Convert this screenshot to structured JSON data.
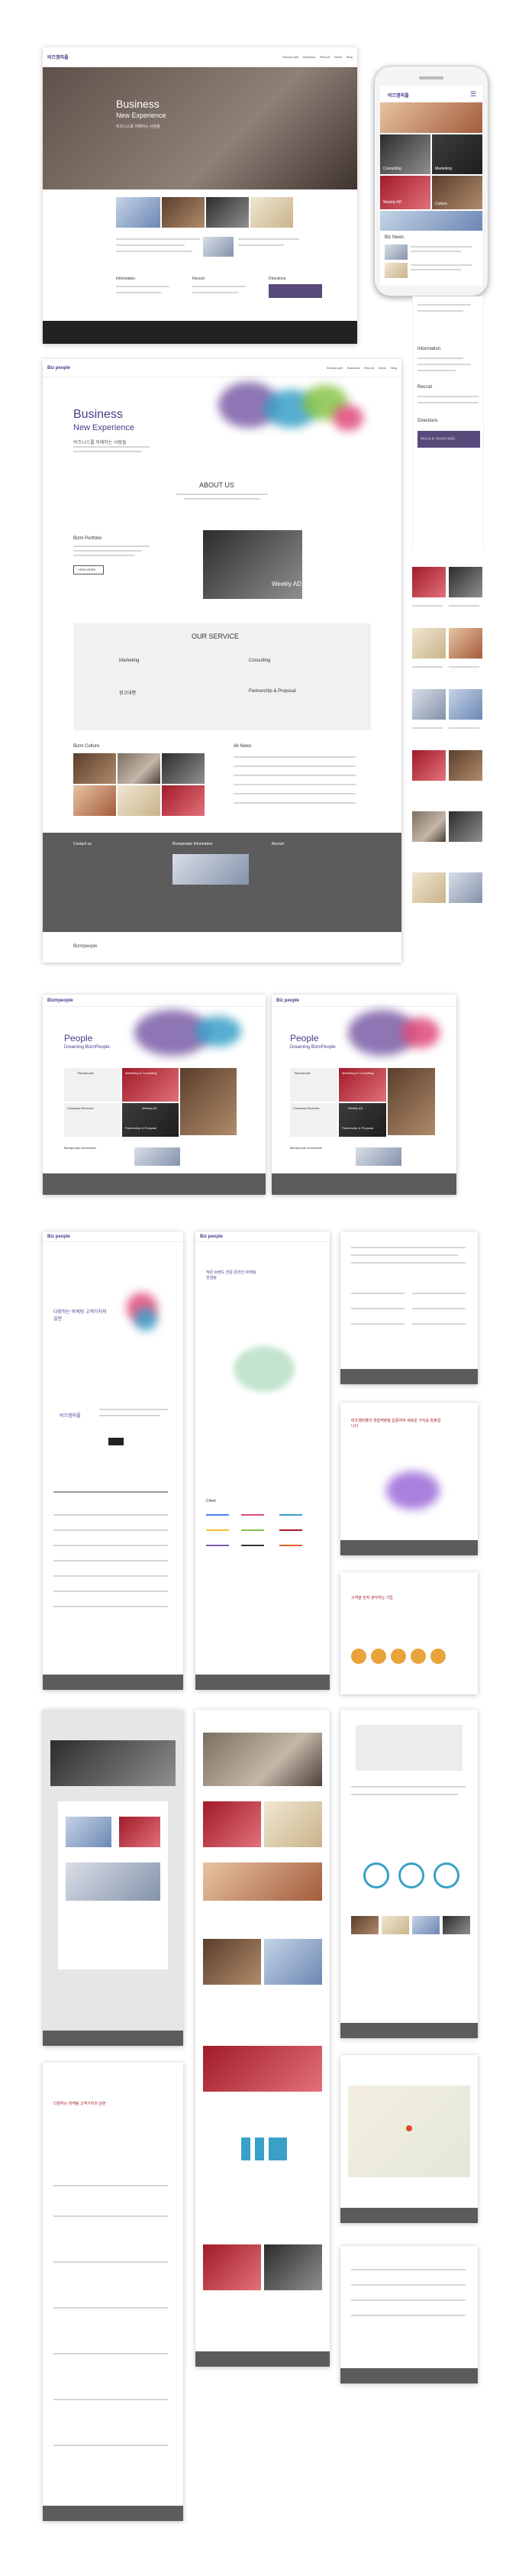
{
  "brand": {
    "logo_text": "비즈엠피플",
    "logo_en": "Biz people",
    "accent": "#574a7a",
    "splash_colors": [
      "#7b5ea7",
      "#3aa0c8",
      "#e04a7a",
      "#88c447",
      "#f2c230"
    ]
  },
  "nav": {
    "items": [
      "Bizmpeople",
      "Business",
      "Recruit",
      "News",
      "Blog"
    ]
  },
  "mock1": {
    "hero_title": "Business",
    "hero_subtitle": "New Experience",
    "hero_desc": "비즈니스를 지배하는 사람들",
    "sections": [
      "Information",
      "Recruit",
      "Directions"
    ]
  },
  "phone": {
    "logo": "비즈엠피플",
    "tile_labels": [
      "Consulting",
      "Marketing",
      "Culture"
    ],
    "weekly_label": "Weekly AD",
    "news_title": "Biz News",
    "info_title": "Information",
    "recruit_title": "Recruit",
    "directions_title": "Directions",
    "directions_button": "찾아오시는 길 / 회사소개서 다운로드"
  },
  "mock2": {
    "hero_title": "Business",
    "hero_subtitle": "New Experience",
    "hero_desc": "비즈니스를 지배하는 사람들",
    "about_title": "ABOUT US",
    "portfolio_title": "Bizm Portfolio",
    "portfolio_button": "VIEW MORE",
    "weekly_title": "Weekly AD",
    "service_title": "OUR SERVICE",
    "services": [
      "Marketing",
      "Consulting",
      "광고대행",
      "Partnership & Proposal"
    ],
    "culture_title": "Bizm Culture",
    "news_title": "All News",
    "footer_sections": [
      "Contact us",
      "Bizmpeople Information",
      "Recruit"
    ],
    "footer_logo": "Bizmpeople"
  },
  "mock3": {
    "hero_title": "People",
    "hero_subtitle": "Dreaming BizmPeople",
    "cards": [
      "Bizmpeople",
      "Marketing & Consulting",
      "Weekly AD",
      "Company Brochure",
      "Partnership & Proposal"
    ],
    "footer_title": "Bizmpeople Information"
  },
  "mock4": {
    "hero_title": "People",
    "hero_subtitle": "Dreaming BizmPeople",
    "cards": [
      "Bizmpeople",
      "Marketing & Consulting",
      "Weekly AD",
      "Company Brochure",
      "Partnership & Proposal"
    ],
    "footer_title": "Bizmpeople Information"
  },
  "sub1": {
    "headline": "다양하는 마케팅 고객가치의 실현",
    "button": "비즈엠피플"
  },
  "sub2": {
    "headline": "작은 브랜드 전문 온라인 마케팅 컨설팅",
    "section": "Client"
  },
  "sub4": {
    "headline": "비즈엠피플의 학습역량을 집중하여 새로운 가치를 창출합니다"
  },
  "sub5": {
    "headline": "고객을 먼저 생각하는 기업"
  }
}
